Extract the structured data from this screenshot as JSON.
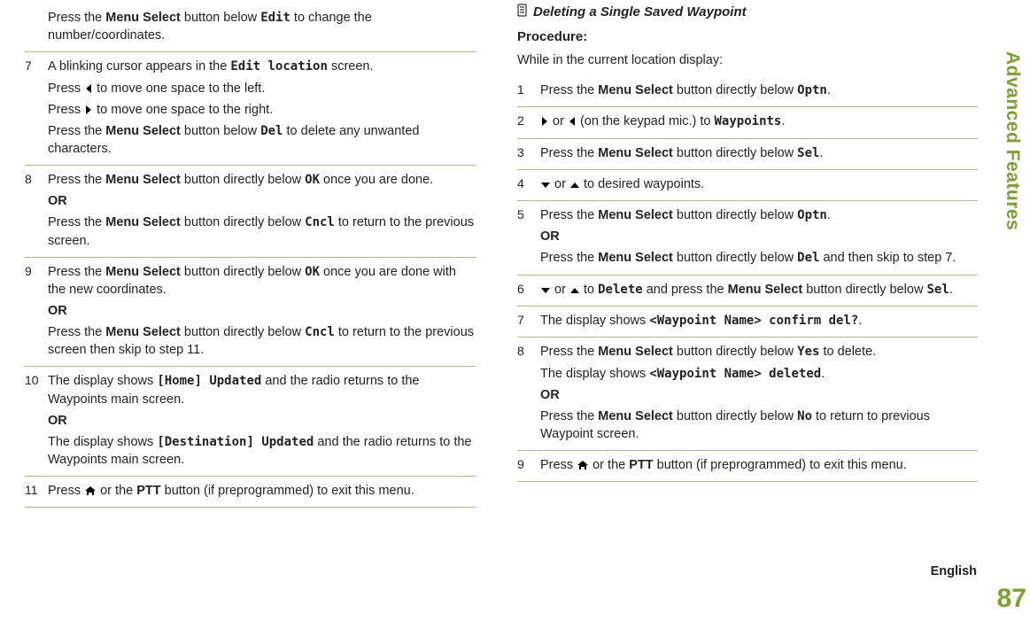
{
  "sidebar": {
    "label": "Advanced Features"
  },
  "page_number": "87",
  "language_label": "English",
  "left": {
    "steps": [
      {
        "num": "",
        "parts": [
          {
            "pre": "Press the ",
            "bold1": "Menu Select",
            "mid1": " button below ",
            "mono1": "Edit",
            "post1": " to change the number/coordinates."
          }
        ]
      },
      {
        "num": "7",
        "parts": [
          {
            "p1a": "A blinking cursor appears in the ",
            "p1mono": "Edit location",
            "p1b": " screen."
          },
          {
            "p2a": "Press ",
            "p2icon": "left",
            "p2b": " to move one space to the left."
          },
          {
            "p3a": "Press ",
            "p3icon": "right",
            "p3b": " to move one space to the right."
          },
          {
            "p4a": "Press the ",
            "p4bold": "Menu Select",
            "p4b": " button below ",
            "p4mono": "Del",
            "p4c": " to delete any unwanted characters."
          }
        ]
      },
      {
        "num": "8",
        "parts": [
          {
            "p1a": "Press the ",
            "p1bold": "Menu Select",
            "p1b": " button directly below ",
            "p1mono": "OK",
            "p1c": " once you are done."
          },
          {
            "or": "OR"
          },
          {
            "p2a": "Press the ",
            "p2bold": "Menu Select",
            "p2b": " button directly below ",
            "p2mono": "Cncl",
            "p2c": " to return to the previous screen."
          }
        ]
      },
      {
        "num": "9",
        "parts": [
          {
            "p1a": "Press the ",
            "p1bold": "Menu Select",
            "p1b": " button directly below ",
            "p1mono": "OK",
            "p1c": " once you are done with the new coordinates."
          },
          {
            "or": "OR"
          },
          {
            "p2a": "Press the ",
            "p2bold": "Menu Select",
            "p2b": " button directly below ",
            "p2mono": "Cncl",
            "p2c": " to return to the previous screen then skip to step 11."
          }
        ]
      },
      {
        "num": "10",
        "parts": [
          {
            "p1a": "The display shows ",
            "p1mono": "[Home] Updated",
            "p1b": " and the radio returns to the Waypoints main screen."
          },
          {
            "or": "OR"
          },
          {
            "p2a": "The display shows ",
            "p2mono": "[Destination] Updated",
            "p2b": " and the radio returns to the Waypoints main screen."
          }
        ]
      },
      {
        "num": "11",
        "parts": [
          {
            "p1a": "Press ",
            "p1icon": "home",
            "p1b": " or the ",
            "p1bold": "PTT",
            "p1c": " button (if preprogrammed) to exit this menu."
          }
        ]
      }
    ]
  },
  "right": {
    "heading": "Deleting a Single Saved Waypoint",
    "procedure_label": "Procedure:",
    "intro": "While in the current location display:",
    "steps": [
      {
        "num": "1",
        "parts": [
          {
            "p1a": "Press the ",
            "p1bold": "Menu Select",
            "p1b": " button directly below ",
            "p1mono": "Optn",
            "p1c": "."
          }
        ]
      },
      {
        "num": "2",
        "parts": [
          {
            "p1icon1": "right",
            "p1a": " or ",
            "p1icon2": "left",
            "p1b": " (on the keypad mic.) to ",
            "p1mono": "Waypoints",
            "p1c": "."
          }
        ]
      },
      {
        "num": "3",
        "parts": [
          {
            "p1a": "Press the ",
            "p1bold": "Menu Select",
            "p1b": " button directly below ",
            "p1mono": "Sel",
            "p1c": "."
          }
        ]
      },
      {
        "num": "4",
        "parts": [
          {
            "p1icon1": "down",
            "p1a": " or ",
            "p1icon2": "up",
            "p1b": " to desired waypoints."
          }
        ]
      },
      {
        "num": "5",
        "parts": [
          {
            "p1a": "Press the ",
            "p1bold": "Menu Select",
            "p1b": " button directly below ",
            "p1mono": "Optn",
            "p1c": "."
          },
          {
            "or": "OR"
          },
          {
            "p2a": "Press the ",
            "p2bold": "Menu Select",
            "p2b": " button directly below ",
            "p2mono": "Del",
            "p2c": " and then skip to step 7."
          }
        ]
      },
      {
        "num": "6",
        "parts": [
          {
            "p1icon1": "down",
            "p1a": " or ",
            "p1icon2": "up",
            "p1b": " to ",
            "p1mono": "Delete",
            "p1c": " and press the ",
            "p1bold": "Menu Select",
            "p1d": " button directly below ",
            "p1mono2": "Sel",
            "p1e": "."
          }
        ]
      },
      {
        "num": "7",
        "parts": [
          {
            "p1a": "The display shows ",
            "p1mono": "<Waypoint Name> confirm del?",
            "p1b": "."
          }
        ]
      },
      {
        "num": "8",
        "parts": [
          {
            "p1a": "Press the ",
            "p1bold": "Menu Select",
            "p1b": " button directly below ",
            "p1mono": "Yes",
            "p1c": " to delete."
          },
          {
            "p2a": "The display shows ",
            "p2mono": "<Waypoint Name> deleted",
            "p2b": "."
          },
          {
            "or": "OR"
          },
          {
            "p3a": "Press the ",
            "p3bold": "Menu Select",
            "p3b": " button directly below ",
            "p3mono": "No",
            "p3c": " to return to previous Waypoint screen."
          }
        ]
      },
      {
        "num": "9",
        "parts": [
          {
            "p1a": "Press ",
            "p1icon": "home",
            "p1b": " or the ",
            "p1bold": "PTT",
            "p1c": " button (if preprogrammed) to exit this menu."
          }
        ]
      }
    ]
  },
  "icons": {
    "left": "left",
    "right": "right",
    "up": "up",
    "down": "down",
    "home": "home",
    "doc": "doc"
  }
}
